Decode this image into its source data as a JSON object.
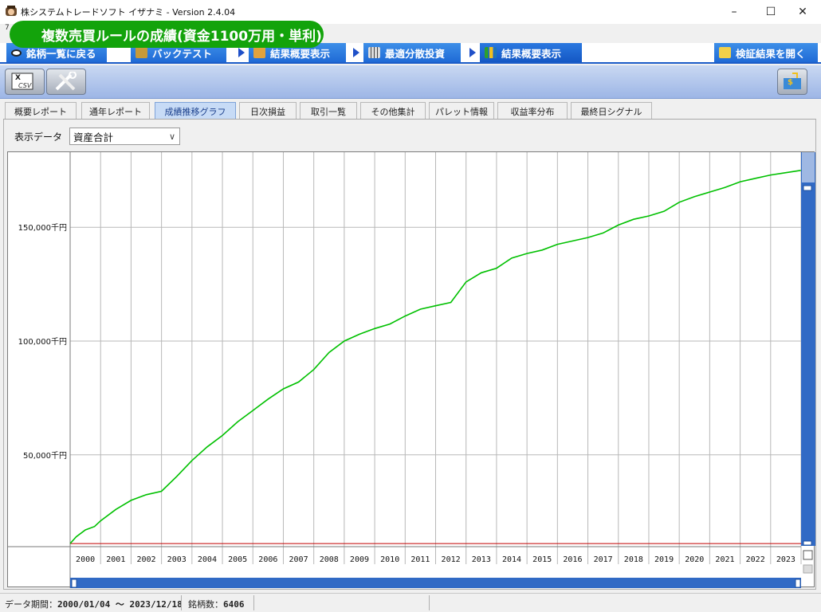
{
  "window": {
    "title": "株システムトレードソフト イザナミ - Version 2.4.04",
    "subtitle": "7",
    "minimize": "–",
    "maximize": "☐",
    "close": "✕"
  },
  "badge": "複数売買ルールの成績(資金1100万用・単利)",
  "nav": {
    "back": "銘柄一覧に戻る",
    "backtest": "バックテスト",
    "summary_show": "結果概要表示",
    "optimize": "最適分散投資",
    "summary_active": "結果概要表示",
    "open_results": "検証結果を開く"
  },
  "toolbar": {
    "csv_label": "CSV"
  },
  "tabs": [
    "概要レポート",
    "通年レポート",
    "成績推移グラフ",
    "日次損益",
    "取引一覧",
    "その他集計",
    "パレット情報",
    "収益率分布",
    "最終日シグナル"
  ],
  "active_tab": "成績推移グラフ",
  "display_data": {
    "label": "表示データ",
    "selected": "資産合計"
  },
  "colors": {
    "line": "#00c000",
    "baseline": "#c00000",
    "scrollbar": "#316ac5",
    "badge": "#13a30b",
    "nav": "#1f6ad6"
  },
  "chart_data": {
    "type": "line",
    "series": [
      {
        "name": "資産合計",
        "x": [
          2000.0,
          2000.2,
          2000.5,
          2000.8,
          2001.0,
          2001.5,
          2002.0,
          2002.5,
          2003.0,
          2003.5,
          2004.0,
          2004.5,
          2005.0,
          2005.5,
          2006.0,
          2006.5,
          2007.0,
          2007.5,
          2008.0,
          2008.5,
          2009.0,
          2009.5,
          2010.0,
          2010.5,
          2011.0,
          2011.5,
          2012.0,
          2012.5,
          2013.0,
          2013.5,
          2014.0,
          2014.5,
          2015.0,
          2015.5,
          2016.0,
          2016.5,
          2017.0,
          2017.5,
          2018.0,
          2018.5,
          2019.0,
          2019.5,
          2020.0,
          2020.5,
          2021.0,
          2021.5,
          2022.0,
          2022.5,
          2023.0,
          2023.5,
          2023.99
        ],
        "y": [
          11000,
          14000,
          17000,
          18500,
          21000,
          26000,
          30000,
          32500,
          34000,
          40500,
          47500,
          53500,
          58500,
          64500,
          69500,
          74500,
          79000,
          82000,
          87500,
          95000,
          100000,
          103000,
          105500,
          107500,
          111000,
          114000,
          115500,
          117000,
          126000,
          130000,
          132000,
          136500,
          138500,
          140000,
          142500,
          144000,
          145500,
          147500,
          151000,
          153500,
          155000,
          157000,
          161000,
          163500,
          165500,
          167500,
          170000,
          171500,
          173000,
          174000,
          175000
        ]
      }
    ],
    "baseline": 11000,
    "x_ticks": [
      "2000",
      "2001",
      "2002",
      "2003",
      "2004",
      "2005",
      "2006",
      "2007",
      "2008",
      "2009",
      "2010",
      "2011",
      "2012",
      "2013",
      "2014",
      "2015",
      "2016",
      "2017",
      "2018",
      "2019",
      "2020",
      "2021",
      "2022",
      "2023"
    ],
    "y_ticks": [
      "50,000千円",
      "100,000千円",
      "150,000千円"
    ],
    "y_tick_values": [
      50000,
      100000,
      150000
    ],
    "xlim": [
      2000,
      2024
    ],
    "ylim": [
      10000,
      183000
    ],
    "grid": true
  },
  "status": {
    "period_label": "データ期間：",
    "period_value": "2000/01/04 ～ 2023/12/18",
    "count_label": "銘柄数：",
    "count_value": "6406"
  }
}
